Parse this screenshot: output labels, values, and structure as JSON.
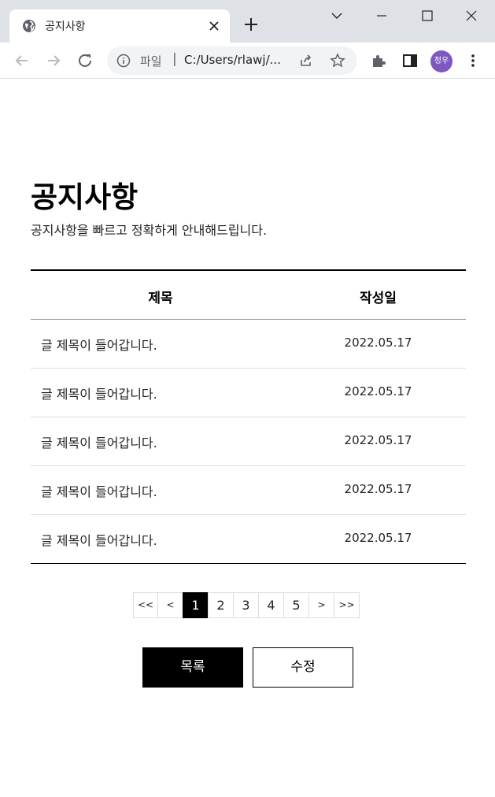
{
  "browser": {
    "tab_title": "공지사항",
    "address_scheme": "파일",
    "address_separator": "|",
    "address_url": "C:/Users/rlawj/...",
    "profile_initials": "정우",
    "profile_color": "#7e57c2"
  },
  "notice": {
    "title": "공지사항",
    "subtitle": "공지사항을 빠르고 정확하게 안내해드립니다.",
    "columns": {
      "title": "제목",
      "date": "작성일"
    },
    "rows": [
      {
        "title": "글 제목이 들어갑니다.",
        "date": "2022.05.17"
      },
      {
        "title": "글 제목이 들어갑니다.",
        "date": "2022.05.17"
      },
      {
        "title": "글 제목이 들어갑니다.",
        "date": "2022.05.17"
      },
      {
        "title": "글 제목이 들어갑니다.",
        "date": "2022.05.17"
      },
      {
        "title": "글 제목이 들어갑니다.",
        "date": "2022.05.17"
      }
    ]
  },
  "pagination": {
    "first": "<<",
    "prev": "<",
    "pages": [
      "1",
      "2",
      "3",
      "4",
      "5"
    ],
    "current": "1",
    "next": ">",
    "last": ">>"
  },
  "actions": {
    "list_label": "목록",
    "edit_label": "수정"
  }
}
